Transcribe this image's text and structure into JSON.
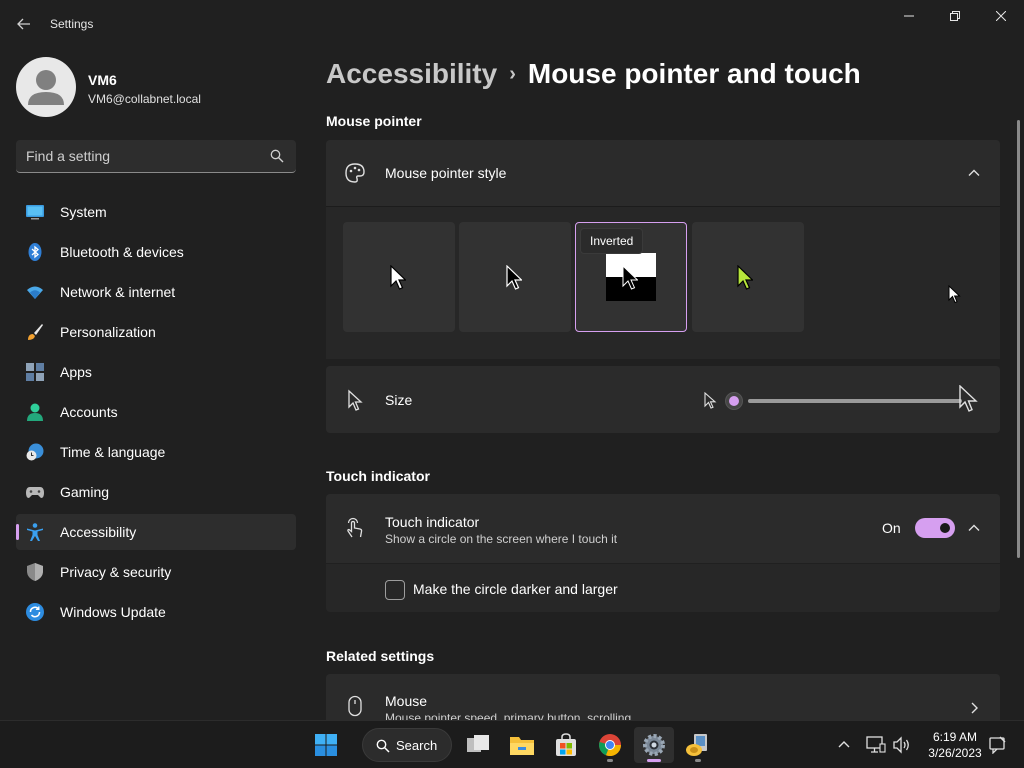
{
  "window": {
    "title": "Settings",
    "controls": [
      "minimize",
      "maximize",
      "close"
    ]
  },
  "user": {
    "name": "VM6",
    "email": "VM6@collabnet.local"
  },
  "search": {
    "placeholder": "Find a setting"
  },
  "sidebar": {
    "items": [
      {
        "label": "System",
        "icon": "monitor-icon"
      },
      {
        "label": "Bluetooth & devices",
        "icon": "bluetooth-icon"
      },
      {
        "label": "Network & internet",
        "icon": "wifi-icon"
      },
      {
        "label": "Personalization",
        "icon": "brush-icon"
      },
      {
        "label": "Apps",
        "icon": "apps-icon"
      },
      {
        "label": "Accounts",
        "icon": "person-icon"
      },
      {
        "label": "Time & language",
        "icon": "globe-clock-icon"
      },
      {
        "label": "Gaming",
        "icon": "gamepad-icon"
      },
      {
        "label": "Accessibility",
        "icon": "accessibility-icon",
        "selected": true
      },
      {
        "label": "Privacy & security",
        "icon": "shield-icon"
      },
      {
        "label": "Windows Update",
        "icon": "sync-icon"
      }
    ]
  },
  "breadcrumb": {
    "parent": "Accessibility",
    "separator": "›",
    "current": "Mouse pointer and touch"
  },
  "mouse_pointer": {
    "section_title": "Mouse pointer",
    "style_card_label": "Mouse pointer style",
    "style_tooltip": "Inverted",
    "styles": [
      "white",
      "black",
      "inverted",
      "custom"
    ],
    "selected_style": "inverted",
    "custom_color": "#b7e63b",
    "size_label": "Size",
    "size_value": 1,
    "size_range": [
      1,
      15
    ]
  },
  "touch": {
    "section_title": "Touch indicator",
    "card_label": "Touch indicator",
    "card_desc": "Show a circle on the screen where I touch it",
    "toggle_state": "On",
    "toggle_on": true,
    "darker_label": "Make the circle darker and larger",
    "darker_checked": false
  },
  "related": {
    "section_title": "Related settings",
    "mouse_label": "Mouse",
    "mouse_desc": "Mouse pointer speed, primary button, scrolling"
  },
  "taskbar": {
    "search_label": "Search",
    "apps": [
      "start-icon",
      "task-view-icon",
      "file-explorer-icon",
      "store-icon",
      "chrome-icon",
      "settings-icon",
      "remote-app-icon"
    ],
    "time": "6:19 AM",
    "date": "3/26/2023"
  },
  "colors": {
    "accent": "#d69ff0",
    "background": "#202020",
    "card": "#2b2b2b"
  }
}
